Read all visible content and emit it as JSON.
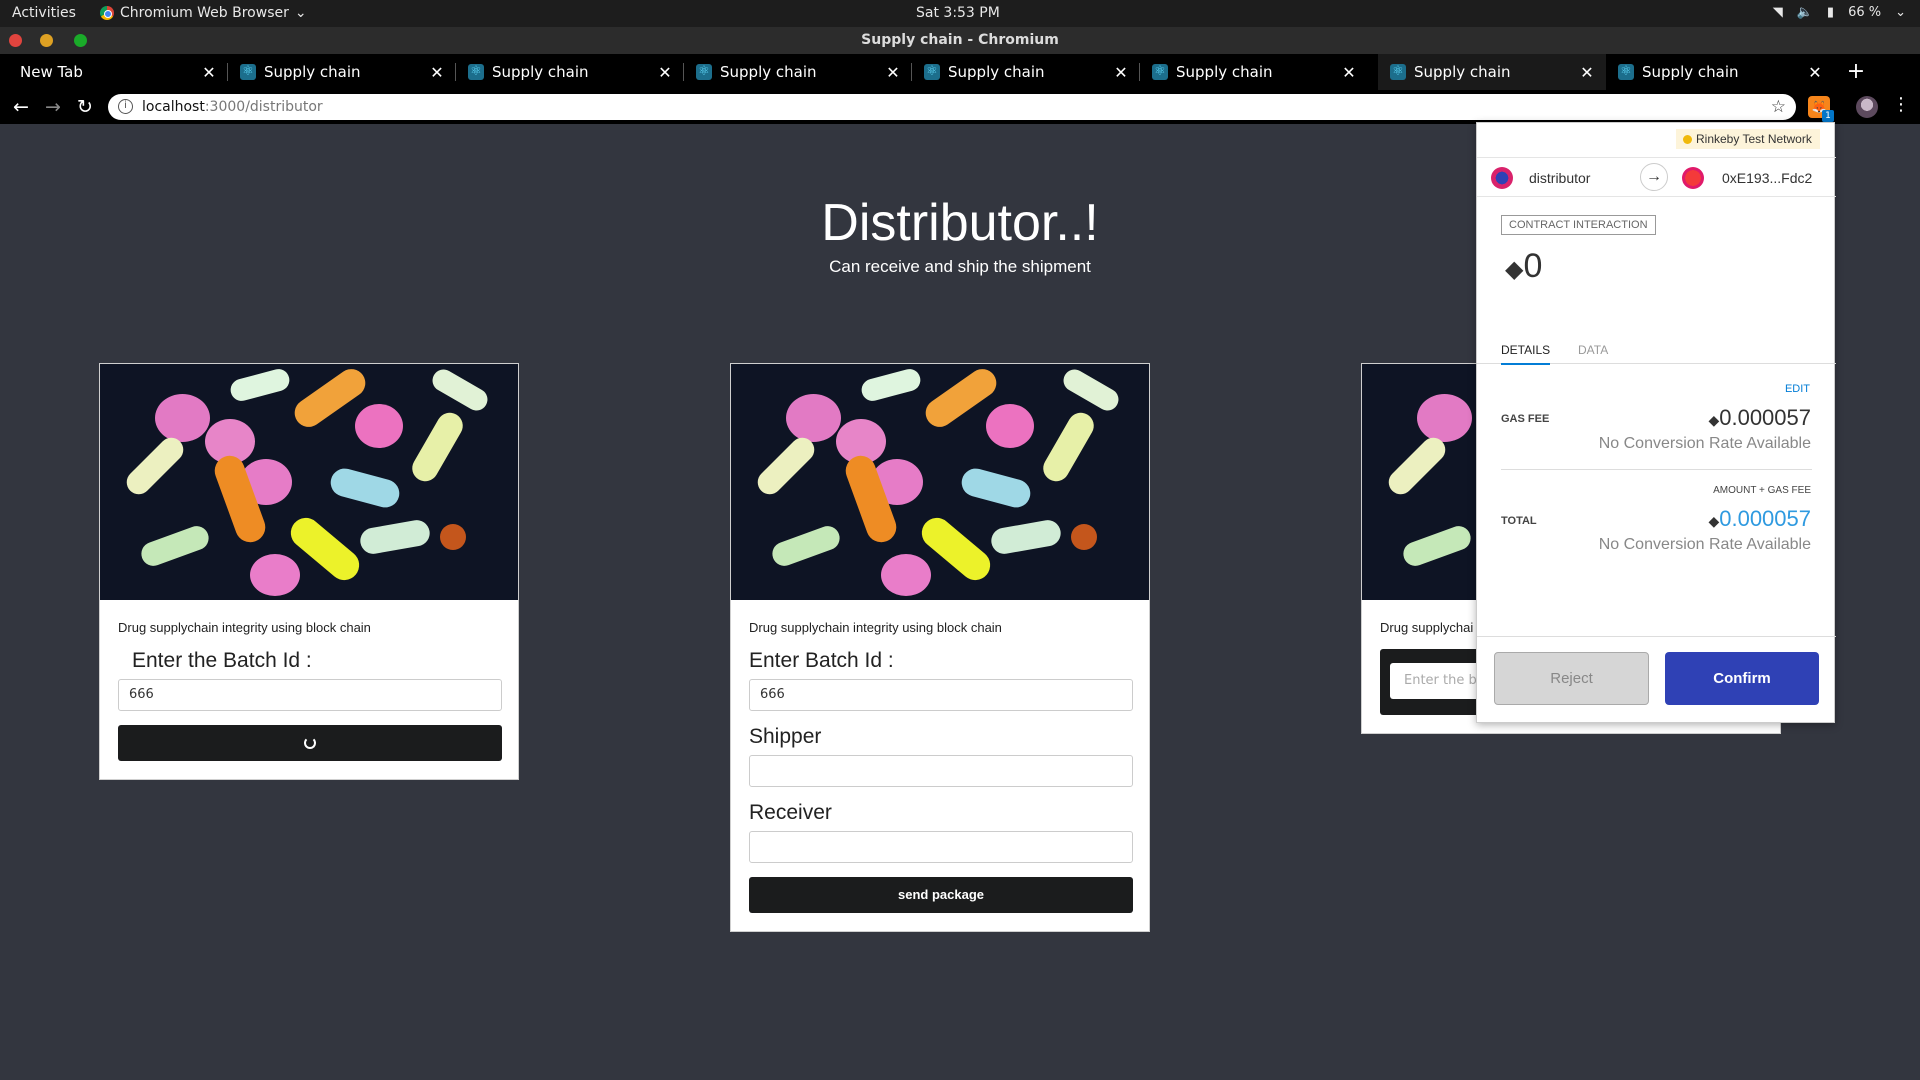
{
  "os": {
    "activities": "Activities",
    "app_name": "Chromium Web Browser",
    "clock": "Sat  3:53 PM",
    "battery": "66 %"
  },
  "window": {
    "title": "Supply chain - Chromium"
  },
  "tabs": [
    {
      "label": "New Tab"
    },
    {
      "label": "Supply chain"
    },
    {
      "label": "Supply chain"
    },
    {
      "label": "Supply chain"
    },
    {
      "label": "Supply chain"
    },
    {
      "label": "Supply chain"
    },
    {
      "label": "Supply chain"
    },
    {
      "label": "Supply chain"
    }
  ],
  "url": {
    "host": "localhost",
    "path": ":3000/distributor"
  },
  "page": {
    "title": "Distributor..!",
    "subtitle": "Can receive and ship the shipment",
    "cards": [
      {
        "caption": "Drug supplychain integrity using block chain",
        "label": "Enter the Batch Id :",
        "value": "666"
      },
      {
        "caption": "Drug supplychain integrity using block chain",
        "batch_label": "Enter Batch Id :",
        "batch_value": "666",
        "shipper_label": "Shipper",
        "receiver_label": "Receiver",
        "button": "send package"
      },
      {
        "caption": "Drug supplychai",
        "placeholder": "Enter the ba"
      }
    ]
  },
  "metamask": {
    "network": "Rinkeby Test Network",
    "from": "distributor",
    "to": "0xE193...Fdc2",
    "type": "CONTRACT INTERACTION",
    "amount": "0",
    "tab_details": "DETAILS",
    "tab_data": "DATA",
    "edit": "EDIT",
    "gas_label": "GAS FEE",
    "gas_value": "0.000057",
    "no_rate": "No Conversion Rate Available",
    "amount_gas": "AMOUNT + GAS FEE",
    "total_label": "TOTAL",
    "total_value": "0.000057",
    "reject": "Reject",
    "confirm": "Confirm"
  },
  "colors": {
    "page_bg": "#33363f",
    "confirm": "#2f41b5",
    "link": "#037dd6"
  }
}
